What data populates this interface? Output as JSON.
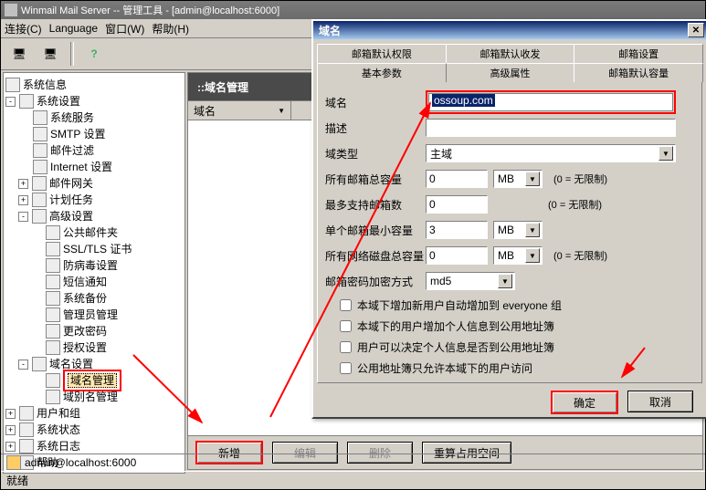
{
  "title": "Winmail Mail Server -- 管理工具 - [admin@localhost:6000]",
  "menu": {
    "connect": "连接(C)",
    "language": "Language",
    "window": "窗口(W)",
    "help": "帮助(H)"
  },
  "tree": {
    "sysinfo": "系统信息",
    "syssettings": "系统设置",
    "svc": "系统服务",
    "smtp": "SMTP 设置",
    "mailfilter": "邮件过滤",
    "internet": "Internet 设置",
    "gateway": "邮件网关",
    "schedule": "计划任务",
    "adv": "高级设置",
    "pubfolder": "公共邮件夹",
    "ssl": "SSL/TLS 证书",
    "av": "防病毒设置",
    "sms": "短信通知",
    "backup": "系统备份",
    "adminmgr": "管理员管理",
    "chpwd": "更改密码",
    "auth": "授权设置",
    "domainset": "域名设置",
    "domainmgr": "域名管理",
    "aliasmgr": "域别名管理",
    "usergroup": "用户和组",
    "sysstate": "系统状态",
    "syslog": "系统日志",
    "helpnode": "帮助"
  },
  "center": {
    "title": "::域名管理",
    "col": "域名",
    "btn_new": "新增",
    "btn_edit": "编辑",
    "btn_del": "删除",
    "btn_recalc": "重算占用空间"
  },
  "dlg": {
    "title": "域名",
    "tabs": {
      "r1a": "邮箱默认权限",
      "r1b": "邮箱默认收发",
      "r1c": "邮箱设置",
      "r2a": "基本参数",
      "r2b": "高级属性",
      "r2c": "邮箱默认容量"
    },
    "f": {
      "domain": "域名",
      "domain_v": "ossoup.com",
      "desc": "描述",
      "desc_v": "",
      "dtype": "域类型",
      "dtype_v": "主域",
      "total": "所有邮箱总容量",
      "total_v": "0",
      "unit": "MB",
      "hint": "(0 = 无限制)",
      "max": "最多支持邮箱数",
      "max_v": "0",
      "min": "单个邮箱最小容量",
      "min_v": "3",
      "disk": "所有网络磁盘总容量",
      "disk_v": "0",
      "enc": "邮箱密码加密方式",
      "enc_v": "md5",
      "c1": "本域下增加新用户自动增加到 everyone 组",
      "c2": "本域下的用户增加个人信息到公用地址簿",
      "c3": "用户可以决定个人信息是否到公用地址簿",
      "c4": "公用地址簿只允许本域下的用户访问"
    },
    "ok": "确定",
    "cancel": "取消"
  },
  "status": {
    "user": "admin@localhost:6000",
    "ready": "就绪"
  }
}
